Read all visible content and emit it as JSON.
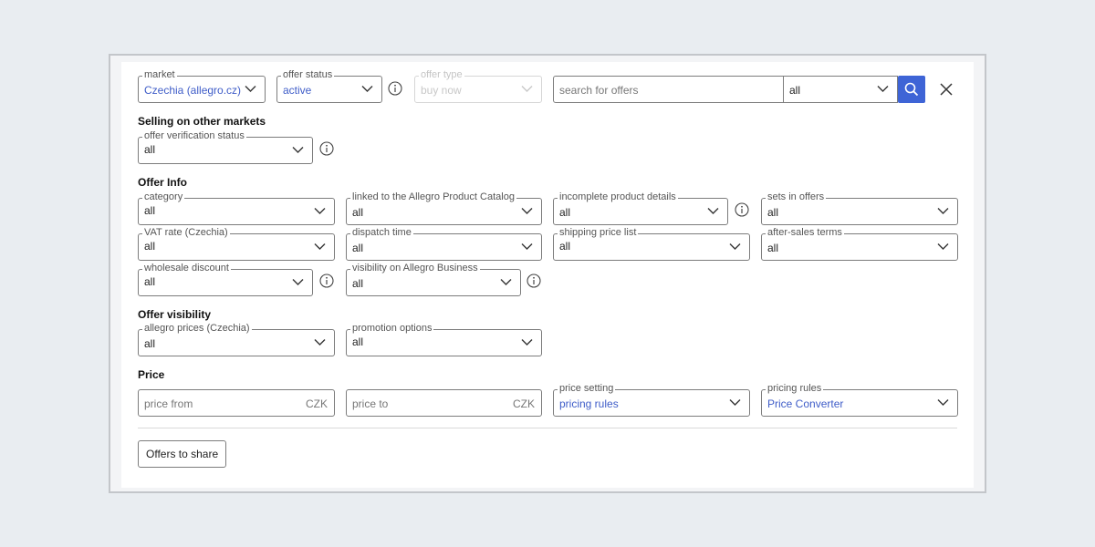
{
  "top_row": {
    "market": {
      "label": "market",
      "value": "Czechia (allegro.cz)"
    },
    "offer_status": {
      "label": "offer status",
      "value": "active"
    },
    "offer_type": {
      "label": "offer type",
      "value": "buy now"
    },
    "search": {
      "placeholder": "search for offers",
      "scope": "all"
    }
  },
  "selling_other_markets": {
    "title": "Selling on other markets",
    "offer_verification_status": {
      "label": "offer verification status",
      "value": "all"
    }
  },
  "offer_info": {
    "title": "Offer Info",
    "category": {
      "label": "category",
      "value": "all"
    },
    "linked_catalog": {
      "label": "linked to the Allegro Product Catalog",
      "value": "all"
    },
    "incomplete_details": {
      "label": "incomplete product details",
      "value": "all"
    },
    "sets_in_offers": {
      "label": "sets in offers",
      "value": "all"
    },
    "vat_rate": {
      "label": "VAT rate (Czechia)",
      "value": "all"
    },
    "dispatch_time": {
      "label": "dispatch time",
      "value": "all"
    },
    "shipping_price_list": {
      "label": "shipping price list",
      "value": "all"
    },
    "after_sales_terms": {
      "label": "after-sales terms",
      "value": "all"
    },
    "wholesale_discount": {
      "label": "wholesale discount",
      "value": "all"
    },
    "visibility_business": {
      "label": "visibility on Allegro Business",
      "value": "all"
    }
  },
  "offer_visibility": {
    "title": "Offer visibility",
    "allegro_prices": {
      "label": "allegro prices (Czechia)",
      "value": "all"
    },
    "promotion_options": {
      "label": "promotion options",
      "value": "all"
    }
  },
  "price": {
    "title": "Price",
    "price_from": {
      "placeholder": "price from",
      "currency": "CZK"
    },
    "price_to": {
      "placeholder": "price to",
      "currency": "CZK"
    },
    "price_setting": {
      "label": "price setting",
      "value": "pricing rules"
    },
    "pricing_rules": {
      "label": "pricing rules",
      "value": "Price Converter"
    }
  },
  "footer": {
    "offers_to_share": "Offers to share"
  },
  "colors": {
    "accent": "#3e64d6",
    "link_text": "#3f5dc8"
  }
}
